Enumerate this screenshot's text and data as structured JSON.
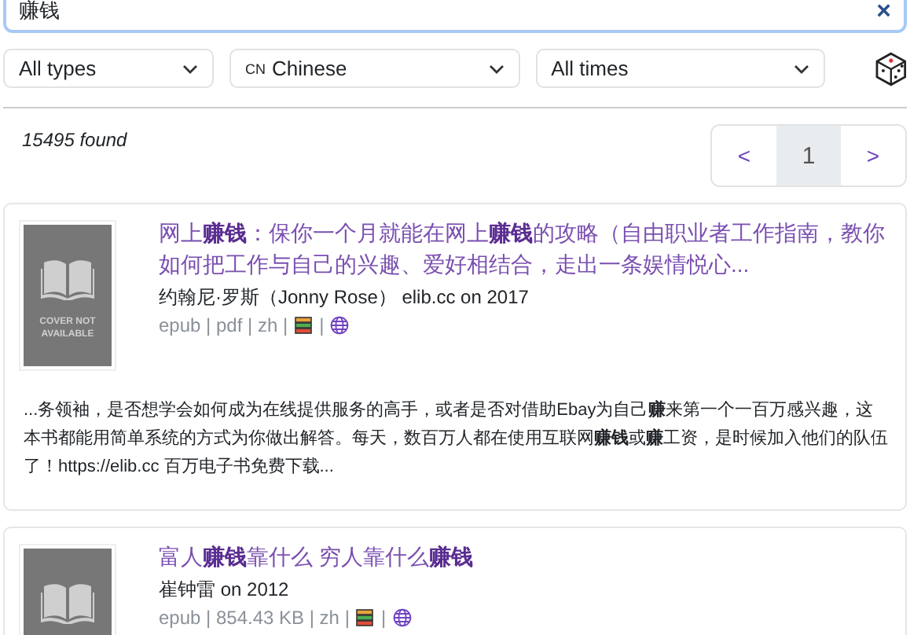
{
  "search": {
    "value": "赚钱",
    "clear": "×"
  },
  "filters": [
    {
      "label": "All types"
    },
    {
      "label": "Chinese",
      "badge": "CN"
    },
    {
      "label": "All times"
    }
  ],
  "results_count": "15495 found",
  "pagination": {
    "prev": "<",
    "next": ">",
    "pages": [
      {
        "label": "1",
        "selected": true
      }
    ]
  },
  "results": [
    {
      "title": "网上**赚钱**：保你一个月就能在网上**赚钱**的攻略（自由职业者工作指南，教你如何把工作与自己的兴趣、爱好相结合，走出一条娱情悦心...",
      "cover_text": "COVER NOT AVAILABLE",
      "byline": "约翰尼·罗斯（Jonny Rose） elib.cc on 2017",
      "meta": "epub | pdf | zh |",
      "meta_separator": "|",
      "snippet": "...务领袖，是否想学会如何成为在线提供服务的高手，或者是否对借助Ebay为自己**赚**来第一个一百万感兴趣，这本书都能用简单系统的方式为你做出解答。每天，数百万人都在使用互联网**赚钱**或**赚**工资，是时候加入他们的队伍了！https://elib.cc 百万电子书免费下载..."
    },
    {
      "title": "富人**赚钱**靠什么 穷人靠什么**赚钱**",
      "byline": "崔钟雷 on 2012",
      "meta": "epub | 854.43 KB | zh |",
      "meta_separator": "|"
    }
  ]
}
